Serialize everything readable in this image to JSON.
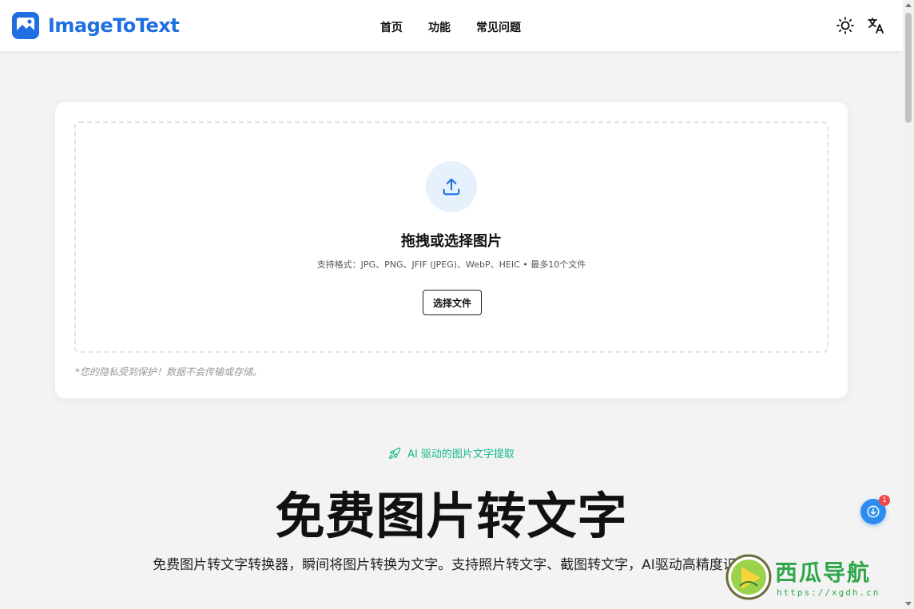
{
  "brand": {
    "name": "ImageToText",
    "logo_icon": "image-logo-icon",
    "accent": "#1f6fe0"
  },
  "nav": {
    "items": [
      "首页",
      "功能",
      "常见问题"
    ]
  },
  "header_icons": {
    "theme": "sun-icon",
    "language": "translate-icon"
  },
  "upload": {
    "icon": "upload-icon",
    "title": "拖拽或选择图片",
    "formats": "支持格式：JPG、PNG、JFIF (JPEG)、WebP、HEIC • 最多10个文件",
    "button": "选择文件",
    "privacy": "*您的隐私受到保护！数据不会传输或存储。"
  },
  "hero": {
    "badge": "AI 驱动的图片文字提取",
    "badge_icon": "rocket-icon",
    "badge_color": "#14b88a",
    "title": "免费图片转文字",
    "description": "免费图片转文字转换器，瞬间将图片转换为文字。支持照片转文字、截图转文字，AI驱动高精度识别"
  },
  "float_button": {
    "icon": "download-icon",
    "badge": "1"
  },
  "watermark": {
    "title": "西瓜导航",
    "url": "https://xgdh.cn"
  }
}
